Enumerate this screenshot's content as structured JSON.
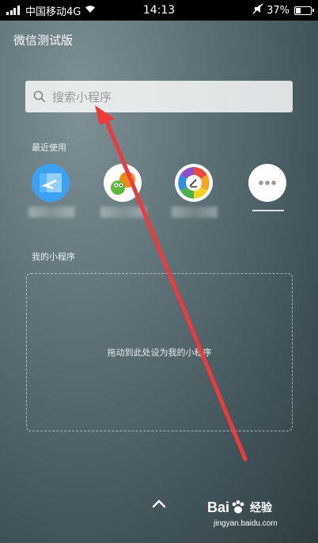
{
  "status_bar": {
    "carrier": "中国移动4G",
    "time": "14:13",
    "battery_percent": "37%",
    "battery_level": 0.37,
    "icons": [
      "signal-icon",
      "wifi-icon",
      "mute-icon",
      "battery-icon"
    ]
  },
  "header": {
    "title": "微信测试版"
  },
  "search": {
    "placeholder": "搜索小程序",
    "icon": "search-icon"
  },
  "recent": {
    "label": "最近使用",
    "items": [
      {
        "icon": "flight-app-icon",
        "color": "#3da1f2"
      },
      {
        "icon": "cartoon-app-icon",
        "color": "#f28a1c"
      },
      {
        "icon": "camera-app-icon",
        "color": "#e5a11f"
      },
      {
        "icon": "more-icon",
        "color": "#d8d8d8"
      }
    ]
  },
  "my_programs": {
    "label": "我的小程序",
    "drop_hint": "拖动到此处设为我的小程序"
  },
  "bottom": {
    "icon": "chevron-up-icon"
  },
  "annotation": {
    "color": "#ee3a3a"
  },
  "watermark": {
    "brand_latin": "Bai",
    "brand_cn": "经验",
    "url": "jingyan.baidu.com"
  }
}
